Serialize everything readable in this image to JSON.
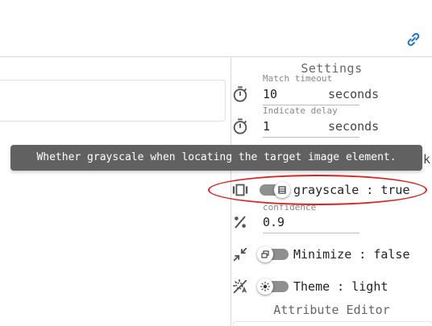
{
  "settings": {
    "title": "Settings",
    "match_timeout": {
      "label": "Match timeout",
      "value": "10",
      "unit": "seconds"
    },
    "indicate_delay": {
      "label": "Indicate delay",
      "value": "1",
      "unit": "seconds"
    },
    "grayscale": {
      "text": "grayscale : true",
      "on": true
    },
    "confidence": {
      "label": "confidence",
      "value": "0.9"
    },
    "minimize": {
      "text": "Minimize : false",
      "on": false
    },
    "theme": {
      "text": "Theme : light",
      "on": false
    },
    "attribute_editor": "Attribute Editor"
  },
  "tooltip": {
    "text": "Whether grayscale when locating the target image element.",
    "peek": "k"
  },
  "icons": {
    "link": "link-icon",
    "timer": "timer-icon",
    "grayscale": "view-carousel-icon",
    "percent": "percent-icon",
    "minimize": "minimize-arrows-icon",
    "theme": "theme-auto-icon"
  },
  "colors": {
    "accent": "#1976d2",
    "tooltip_bg": "#616161",
    "highlight": "#e02020"
  }
}
